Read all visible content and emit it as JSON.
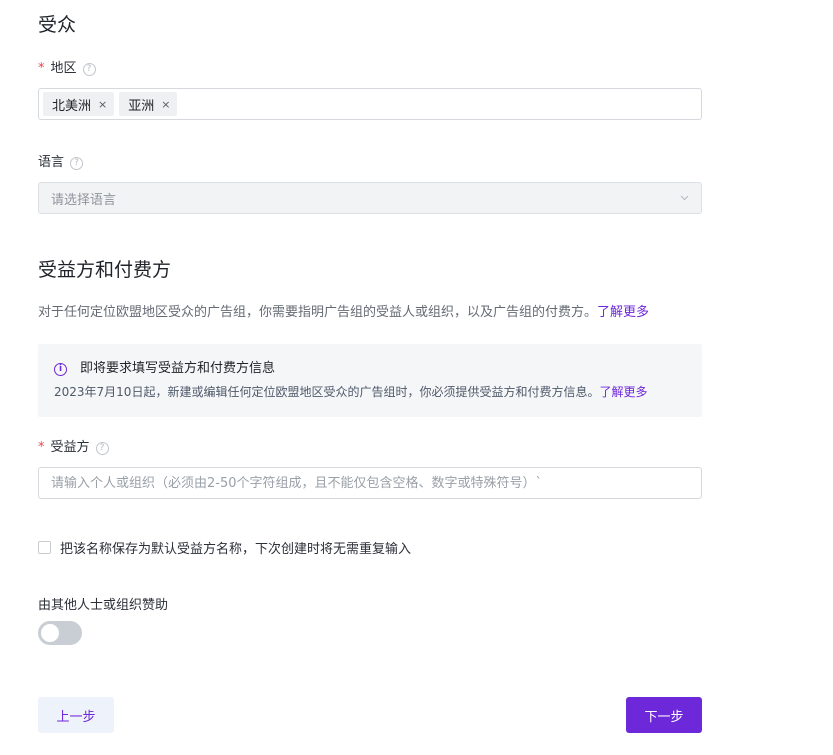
{
  "audience": {
    "title": "受众",
    "region": {
      "label": "地区",
      "tags": [
        "北美洲",
        "亚洲"
      ],
      "remove_glyph": "×"
    },
    "language": {
      "label": "语言",
      "placeholder": "请选择语言"
    }
  },
  "beneficiary": {
    "title": "受益方和付费方",
    "description": "对于任何定位欧盟地区受众的广告组，你需要指明广告组的受益人或组织，以及广告组的付费方。",
    "learn_more": "了解更多",
    "info": {
      "title": "即将要求填写受益方和付费方信息",
      "text": "2023年7月10日起，新建或编辑任何定位欧盟地区受众的广告组时，你必须提供受益方和付费方信息。",
      "learn_more": "了解更多"
    },
    "field": {
      "label": "受益方",
      "placeholder": "请输入个人或组织（必须由2-50个字符组成，且不能仅包含空格、数字或特殊符号）`"
    },
    "save_default": "把该名称保存为默认受益方名称，下次创建时将无需重复输入",
    "sponsored": {
      "label": "由其他人士或组织赞助",
      "enabled": false
    }
  },
  "footer": {
    "prev": "上一步",
    "next": "下一步"
  },
  "colors": {
    "accent": "#6d28d9",
    "required": "#e5484d"
  }
}
